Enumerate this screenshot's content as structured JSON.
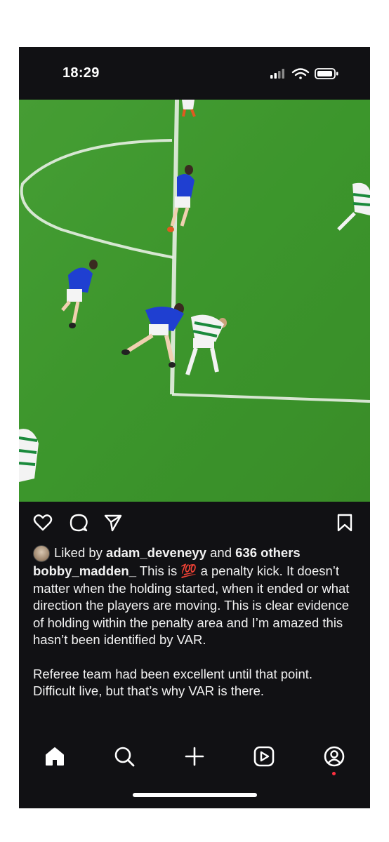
{
  "status_bar": {
    "time": "18:29",
    "icons": [
      "cellular-signal-icon",
      "wifi-icon",
      "battery-icon"
    ]
  },
  "post": {
    "media_description_icons": [
      "heart-icon",
      "comment-icon",
      "share-icon",
      "bookmark-icon"
    ],
    "likes": {
      "prefix": "Liked by ",
      "liked_by_user": "adam_deveneyy",
      "conjunction": " and ",
      "others": "636 others"
    },
    "caption": {
      "username": "bobby_madden_",
      "line1_text": " This is ",
      "emoji": "💯",
      "line1_rest": " a penalty kick. It doesn’t matter when the holding started, when it ended or what direction the players are moving. This is clear evidence of holding within the penalty area and I’m amazed this hasn’t been identified by VAR.",
      "paragraph2": "Referee team had been excellent until that point.",
      "paragraph3": "Difficult live, but that’s why VAR is there."
    }
  },
  "bottom_nav": {
    "items": [
      "home-icon",
      "search-icon",
      "create-icon",
      "reels-icon",
      "profile-icon"
    ]
  },
  "colors": {
    "background": "#111114",
    "text": "#f2f2f2",
    "pitch": "#3f9a2e",
    "notification": "#ff3040",
    "emoji_red": "#e0245e"
  }
}
